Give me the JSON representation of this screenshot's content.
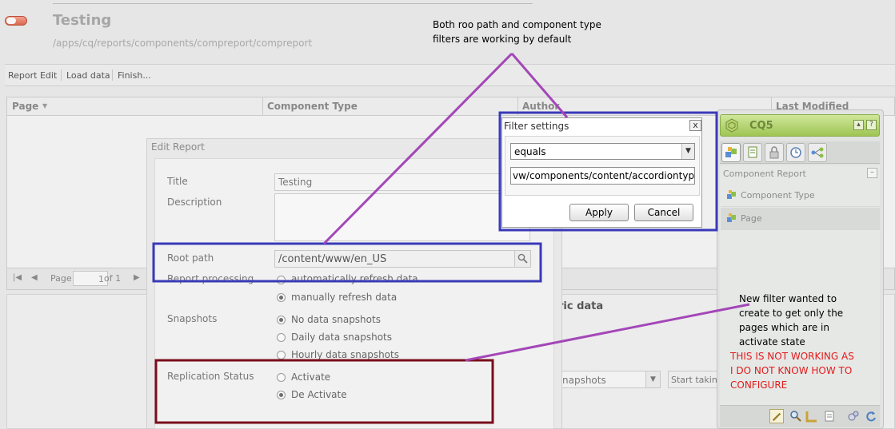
{
  "app": {
    "title": "Testing",
    "path": "/apps/cq/reports/components/compreport/compreport"
  },
  "toolbar": {
    "report_edit": "Report Edit",
    "load_data": "Load data",
    "finish": "Finish..."
  },
  "grid": {
    "columns": [
      "Page",
      "Component Type",
      "Author",
      "Last Modified"
    ],
    "pager": {
      "page_label": "Page",
      "page_value": "1",
      "of_label": "of 1"
    }
  },
  "lower": {
    "metric_label": "ric data",
    "snapshots_select": "napshots",
    "start_button": "Start taking"
  },
  "edit_report": {
    "title": "Edit Report",
    "fields": {
      "title_label": "Title",
      "title_value": "Testing",
      "description_label": "Description",
      "root_path_label": "Root path",
      "root_path_value": "/content/www/en_US",
      "report_processing_label": "Report processing",
      "snapshots_label": "Snapshots",
      "replication_label": "Replication Status"
    },
    "processing_options": [
      "automatically refresh data",
      "manually refresh data"
    ],
    "snapshot_options": [
      "No data snapshots",
      "Daily data snapshots",
      "Hourly data snapshots"
    ],
    "replication_options": [
      "Activate",
      "De Activate"
    ]
  },
  "filter": {
    "title": "Filter settings",
    "close": "x",
    "operator": "equals",
    "value": "vw/components/content/accordiontype",
    "apply": "Apply",
    "cancel": "Cancel"
  },
  "sidekick": {
    "title": "CQ5",
    "group": "Component Report",
    "items": [
      "Component Type",
      "Page"
    ]
  },
  "annotations": {
    "top_note": [
      "Both roo path and component type",
      "filters are working by default"
    ],
    "right_note": [
      "New filter wanted to",
      "create to get only the",
      "pages which are in",
      "activate state"
    ],
    "right_warning": [
      "THIS IS NOT WORKING AS",
      "I DO NOT KNOW HOW TO",
      "CONFIGURE"
    ]
  },
  "colors": {
    "annotation_purple": "#a347b8",
    "highlight_blue": "#3a3ab8",
    "highlight_darkred": "#7a0d1a",
    "sidekick_green": "#9fc554",
    "warning_red": "#e11b1b"
  }
}
